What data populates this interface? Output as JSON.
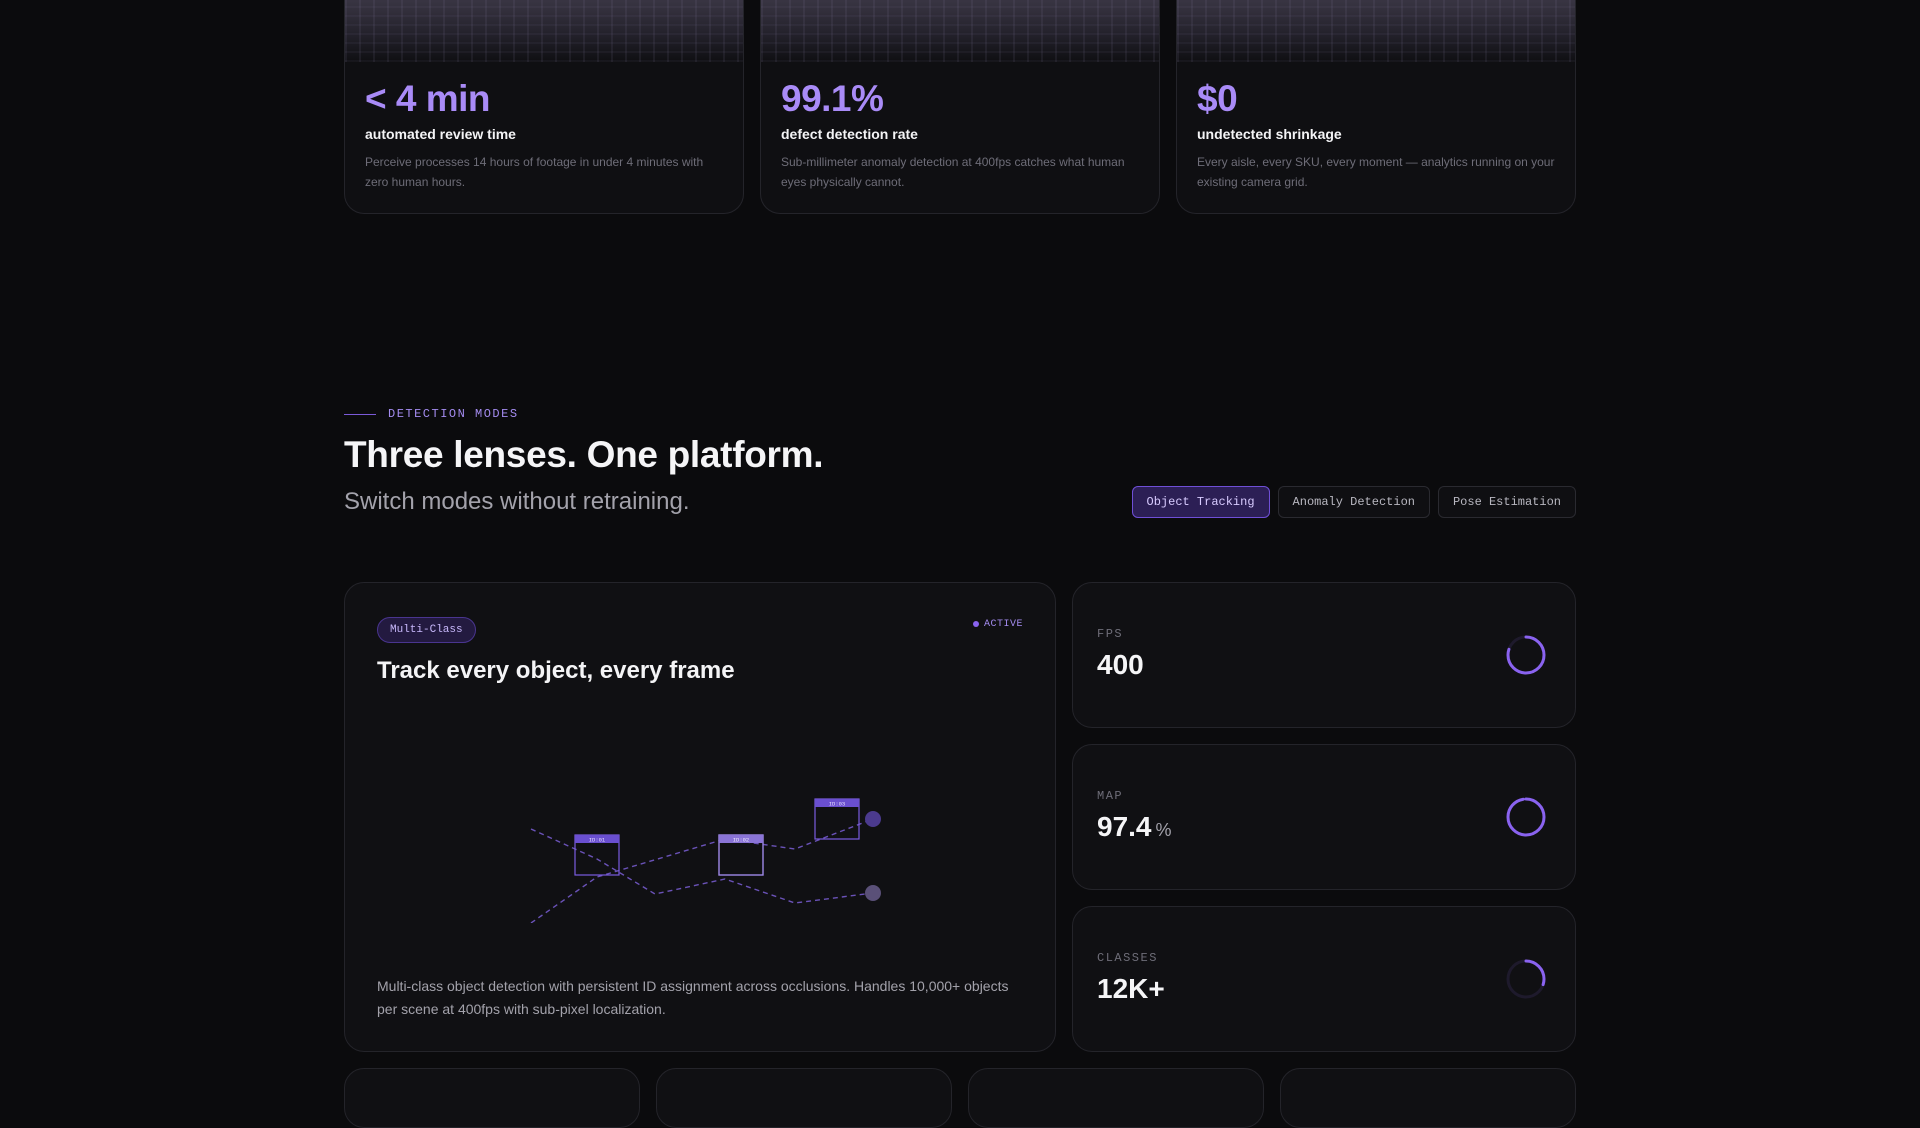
{
  "stats": [
    {
      "value": "< 4 min",
      "label": "automated review time",
      "description": "Perceive processes 14 hours of footage in under 4 minutes with zero human hours."
    },
    {
      "value": "99.1%",
      "label": "defect detection rate",
      "description": "Sub-millimeter anomaly detection at 400fps catches what human eyes physically cannot."
    },
    {
      "value": "$0",
      "label": "undetected shrinkage",
      "description": "Every aisle, every SKU, every moment — analytics running on your existing camera grid."
    }
  ],
  "section": {
    "eyebrow": "DETECTION MODES",
    "title": "Three lenses. One platform.",
    "subtitle": "Switch modes without retraining."
  },
  "tabs": [
    {
      "label": "Object Tracking",
      "active": true
    },
    {
      "label": "Anomaly Detection",
      "active": false
    },
    {
      "label": "Pose Estimation",
      "active": false
    }
  ],
  "feature": {
    "tag": "Multi-Class",
    "status": "ACTIVE",
    "title": "Track every object, every frame",
    "description": "Multi-class object detection with persistent ID assignment across occlusions. Handles 10,000+ objects per scene at 400fps with sub-pixel localization.",
    "box_labels": [
      "ID:01",
      "ID:02",
      "ID:03"
    ]
  },
  "metrics": [
    {
      "label": "FPS",
      "value": "400",
      "unit": "",
      "ring_fraction": 0.8
    },
    {
      "label": "MAP",
      "value": "97.4",
      "unit": "%",
      "ring_fraction": 0.974
    },
    {
      "label": "CLASSES",
      "value": "12K+",
      "unit": "",
      "ring_fraction": 0.3
    }
  ],
  "colors": {
    "accent": "#8a63f0",
    "accent_light": "#a98bf7",
    "background": "#0b0b0d",
    "card": "#101013"
  }
}
